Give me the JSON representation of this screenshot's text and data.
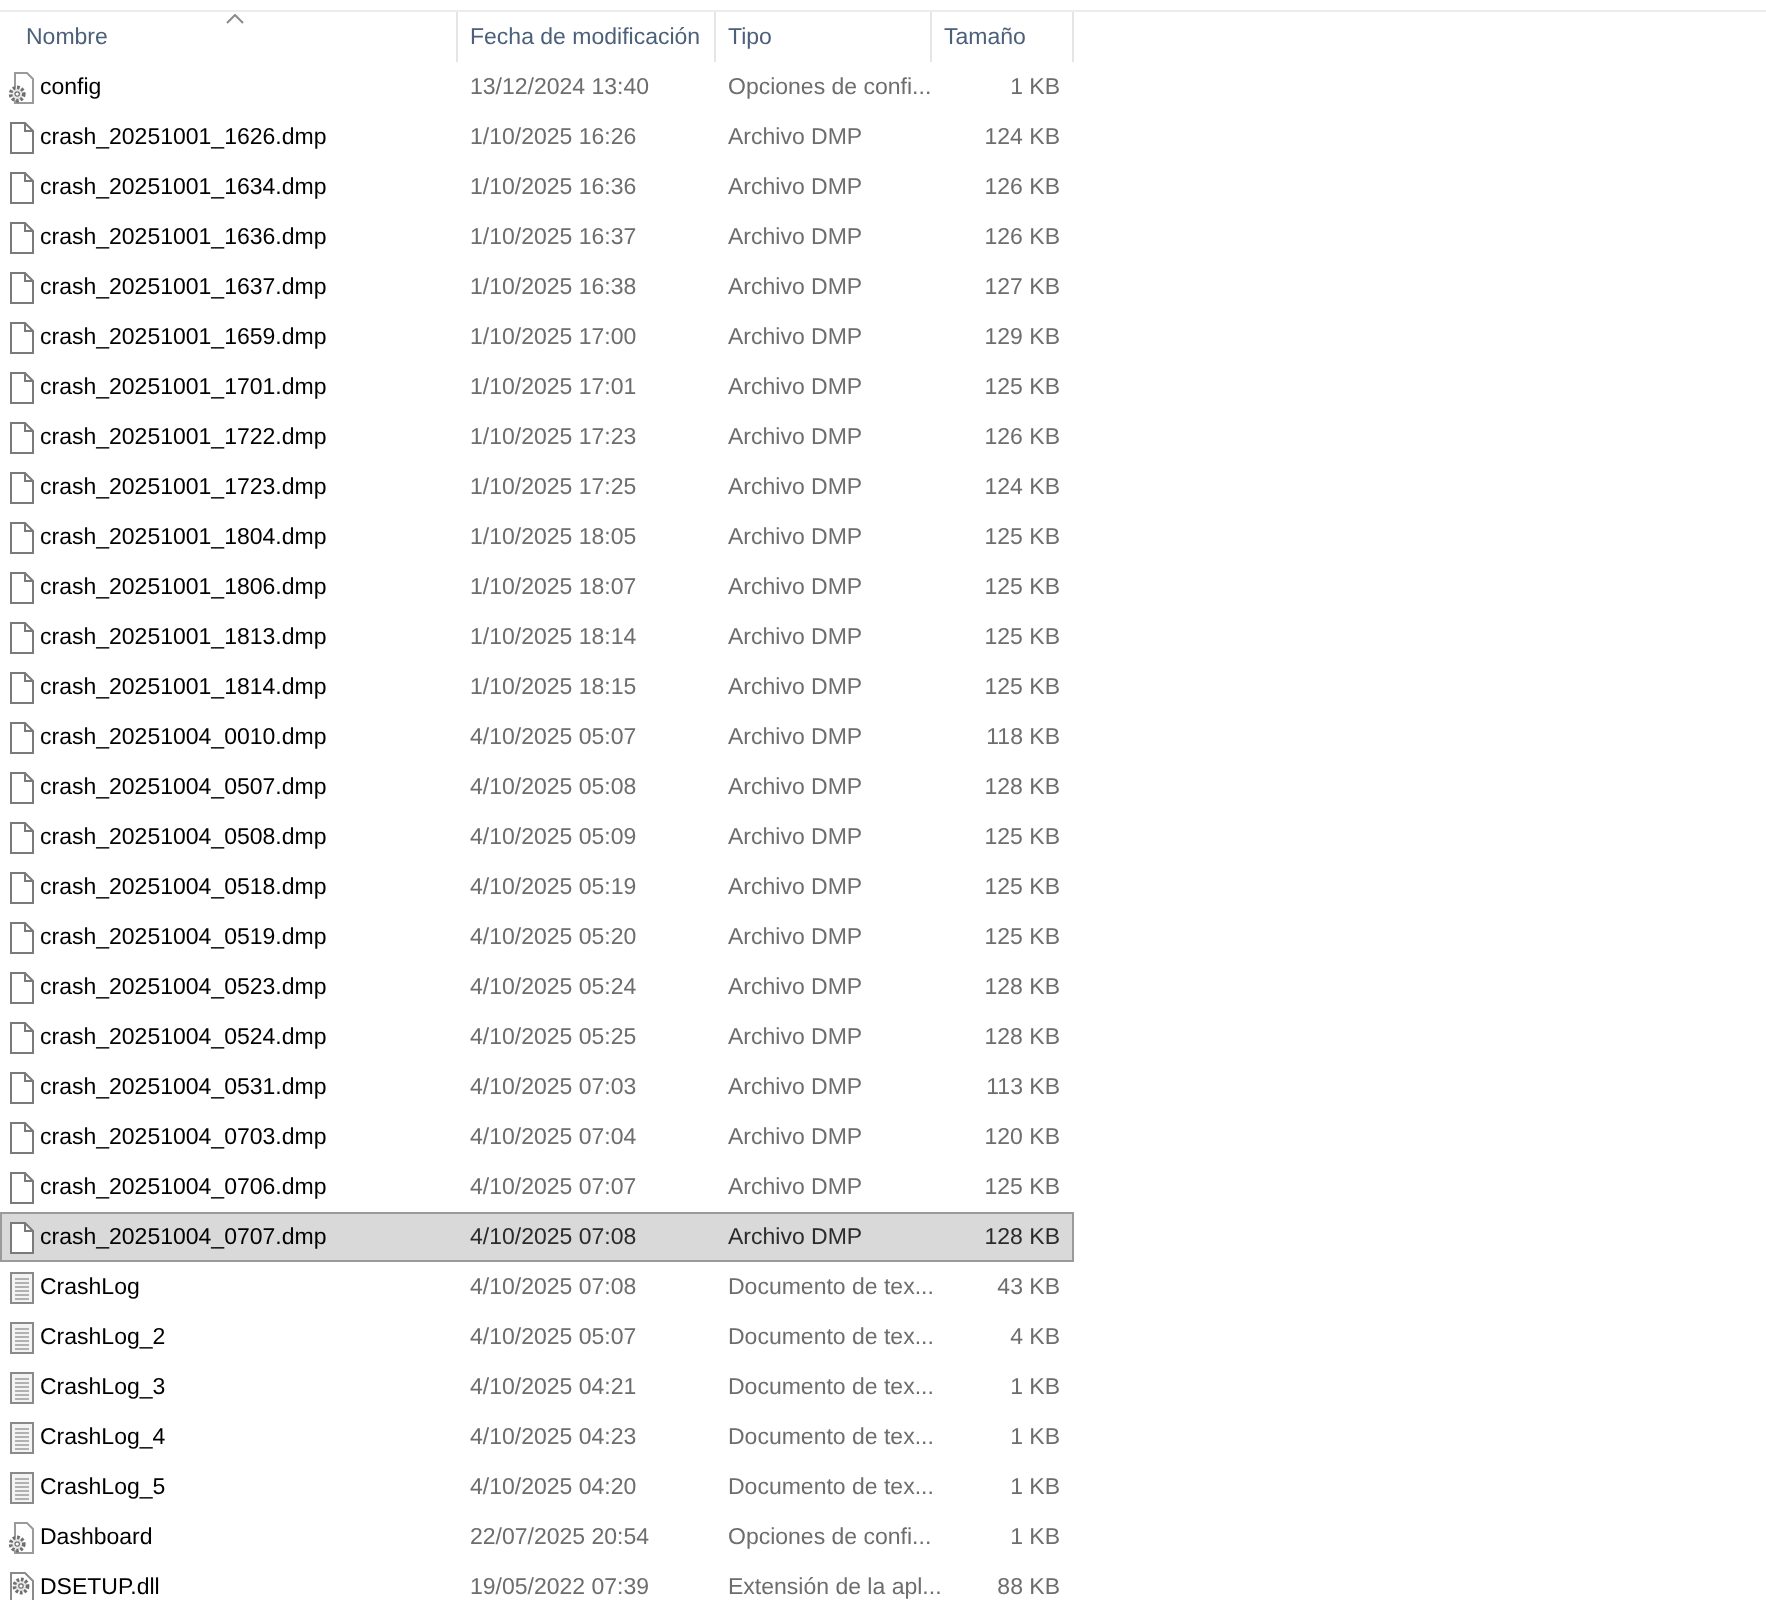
{
  "table": {
    "columns": [
      {
        "label": "Nombre",
        "sorted": true
      },
      {
        "label": "Fecha de modificación",
        "sorted": false
      },
      {
        "label": "Tipo",
        "sorted": false
      },
      {
        "label": "Tamaño",
        "sorted": false
      }
    ],
    "rows": [
      {
        "kind": "config",
        "name": "config",
        "date": "13/12/2024 13:40",
        "type": "Opciones de confi...",
        "size": "1 KB",
        "selected": false
      },
      {
        "kind": "dump",
        "name": "crash_20251001_1626.dmp",
        "date": "1/10/2025 16:26",
        "type": "Archivo DMP",
        "size": "124 KB",
        "selected": false
      },
      {
        "kind": "dump",
        "name": "crash_20251001_1634.dmp",
        "date": "1/10/2025 16:36",
        "type": "Archivo DMP",
        "size": "126 KB",
        "selected": false
      },
      {
        "kind": "dump",
        "name": "crash_20251001_1636.dmp",
        "date": "1/10/2025 16:37",
        "type": "Archivo DMP",
        "size": "126 KB",
        "selected": false
      },
      {
        "kind": "dump",
        "name": "crash_20251001_1637.dmp",
        "date": "1/10/2025 16:38",
        "type": "Archivo DMP",
        "size": "127 KB",
        "selected": false
      },
      {
        "kind": "dump",
        "name": "crash_20251001_1659.dmp",
        "date": "1/10/2025 17:00",
        "type": "Archivo DMP",
        "size": "129 KB",
        "selected": false
      },
      {
        "kind": "dump",
        "name": "crash_20251001_1701.dmp",
        "date": "1/10/2025 17:01",
        "type": "Archivo DMP",
        "size": "125 KB",
        "selected": false
      },
      {
        "kind": "dump",
        "name": "crash_20251001_1722.dmp",
        "date": "1/10/2025 17:23",
        "type": "Archivo DMP",
        "size": "126 KB",
        "selected": false
      },
      {
        "kind": "dump",
        "name": "crash_20251001_1723.dmp",
        "date": "1/10/2025 17:25",
        "type": "Archivo DMP",
        "size": "124 KB",
        "selected": false
      },
      {
        "kind": "dump",
        "name": "crash_20251001_1804.dmp",
        "date": "1/10/2025 18:05",
        "type": "Archivo DMP",
        "size": "125 KB",
        "selected": false
      },
      {
        "kind": "dump",
        "name": "crash_20251001_1806.dmp",
        "date": "1/10/2025 18:07",
        "type": "Archivo DMP",
        "size": "125 KB",
        "selected": false
      },
      {
        "kind": "dump",
        "name": "crash_20251001_1813.dmp",
        "date": "1/10/2025 18:14",
        "type": "Archivo DMP",
        "size": "125 KB",
        "selected": false
      },
      {
        "kind": "dump",
        "name": "crash_20251001_1814.dmp",
        "date": "1/10/2025 18:15",
        "type": "Archivo DMP",
        "size": "125 KB",
        "selected": false
      },
      {
        "kind": "dump",
        "name": "crash_20251004_0010.dmp",
        "date": "4/10/2025 05:07",
        "type": "Archivo DMP",
        "size": "118 KB",
        "selected": false
      },
      {
        "kind": "dump",
        "name": "crash_20251004_0507.dmp",
        "date": "4/10/2025 05:08",
        "type": "Archivo DMP",
        "size": "128 KB",
        "selected": false
      },
      {
        "kind": "dump",
        "name": "crash_20251004_0508.dmp",
        "date": "4/10/2025 05:09",
        "type": "Archivo DMP",
        "size": "125 KB",
        "selected": false
      },
      {
        "kind": "dump",
        "name": "crash_20251004_0518.dmp",
        "date": "4/10/2025 05:19",
        "type": "Archivo DMP",
        "size": "125 KB",
        "selected": false
      },
      {
        "kind": "dump",
        "name": "crash_20251004_0519.dmp",
        "date": "4/10/2025 05:20",
        "type": "Archivo DMP",
        "size": "125 KB",
        "selected": false
      },
      {
        "kind": "dump",
        "name": "crash_20251004_0523.dmp",
        "date": "4/10/2025 05:24",
        "type": "Archivo DMP",
        "size": "128 KB",
        "selected": false
      },
      {
        "kind": "dump",
        "name": "crash_20251004_0524.dmp",
        "date": "4/10/2025 05:25",
        "type": "Archivo DMP",
        "size": "128 KB",
        "selected": false
      },
      {
        "kind": "dump",
        "name": "crash_20251004_0531.dmp",
        "date": "4/10/2025 07:03",
        "type": "Archivo DMP",
        "size": "113 KB",
        "selected": false
      },
      {
        "kind": "dump",
        "name": "crash_20251004_0703.dmp",
        "date": "4/10/2025 07:04",
        "type": "Archivo DMP",
        "size": "120 KB",
        "selected": false
      },
      {
        "kind": "dump",
        "name": "crash_20251004_0706.dmp",
        "date": "4/10/2025 07:07",
        "type": "Archivo DMP",
        "size": "125 KB",
        "selected": false
      },
      {
        "kind": "dump",
        "name": "crash_20251004_0707.dmp",
        "date": "4/10/2025 07:08",
        "type": "Archivo DMP",
        "size": "128 KB",
        "selected": true
      },
      {
        "kind": "text",
        "name": "CrashLog",
        "date": "4/10/2025 07:08",
        "type": "Documento de tex...",
        "size": "43 KB",
        "selected": false
      },
      {
        "kind": "text",
        "name": "CrashLog_2",
        "date": "4/10/2025 05:07",
        "type": "Documento de tex...",
        "size": "4 KB",
        "selected": false
      },
      {
        "kind": "text",
        "name": "CrashLog_3",
        "date": "4/10/2025 04:21",
        "type": "Documento de tex...",
        "size": "1 KB",
        "selected": false
      },
      {
        "kind": "text",
        "name": "CrashLog_4",
        "date": "4/10/2025 04:23",
        "type": "Documento de tex...",
        "size": "1 KB",
        "selected": false
      },
      {
        "kind": "text",
        "name": "CrashLog_5",
        "date": "4/10/2025 04:20",
        "type": "Documento de tex...",
        "size": "1 KB",
        "selected": false
      },
      {
        "kind": "config",
        "name": "Dashboard",
        "date": "22/07/2025 20:54",
        "type": "Opciones de confi...",
        "size": "1 KB",
        "selected": false
      },
      {
        "kind": "library",
        "name": "DSETUP.dll",
        "date": "19/05/2022 07:39",
        "type": "Extensión de la apl...",
        "size": "88 KB",
        "selected": false
      }
    ]
  }
}
